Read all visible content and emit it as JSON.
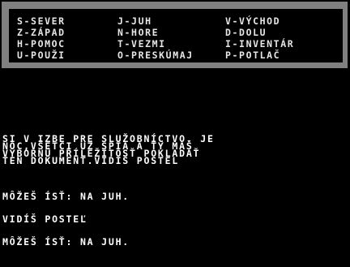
{
  "commands": [
    {
      "label": "S-SEVER"
    },
    {
      "label": "J-JUH"
    },
    {
      "label": "V-VÝCHOD"
    },
    {
      "label": "Z-ZÁPAD"
    },
    {
      "label": "N-HORE"
    },
    {
      "label": "D-DOLU"
    },
    {
      "label": "H-POMOC"
    },
    {
      "label": "T-VEZMI"
    },
    {
      "label": "I-INVENTÁR"
    },
    {
      "label": "U-POUŽI"
    },
    {
      "label": "O-PRESKÚMAJ"
    },
    {
      "label": "P-POTLAČ"
    }
  ],
  "output": {
    "description": [
      "SI V IZBE PRE SLUŽOBNÍCTVO. JE",
      "NOC,VŠETCI UŽ SPIA A TY MÁŠ",
      "VÝBORNÚ PRÍLEŽITOSŤ POKLADAŤ",
      "TEN DOKUMENT.VIDÍŠ POSTEL"
    ],
    "exits_1": "MÔŽEŠ ÍSŤ: NA JUH.",
    "sees": "VIDÍŠ POSTEĽ",
    "exits_2": "MÔŽEŠ ÍSŤ: NA JUH."
  },
  "colors": {
    "background": "#000000",
    "frame": "#808080",
    "text": "#ffffff"
  }
}
